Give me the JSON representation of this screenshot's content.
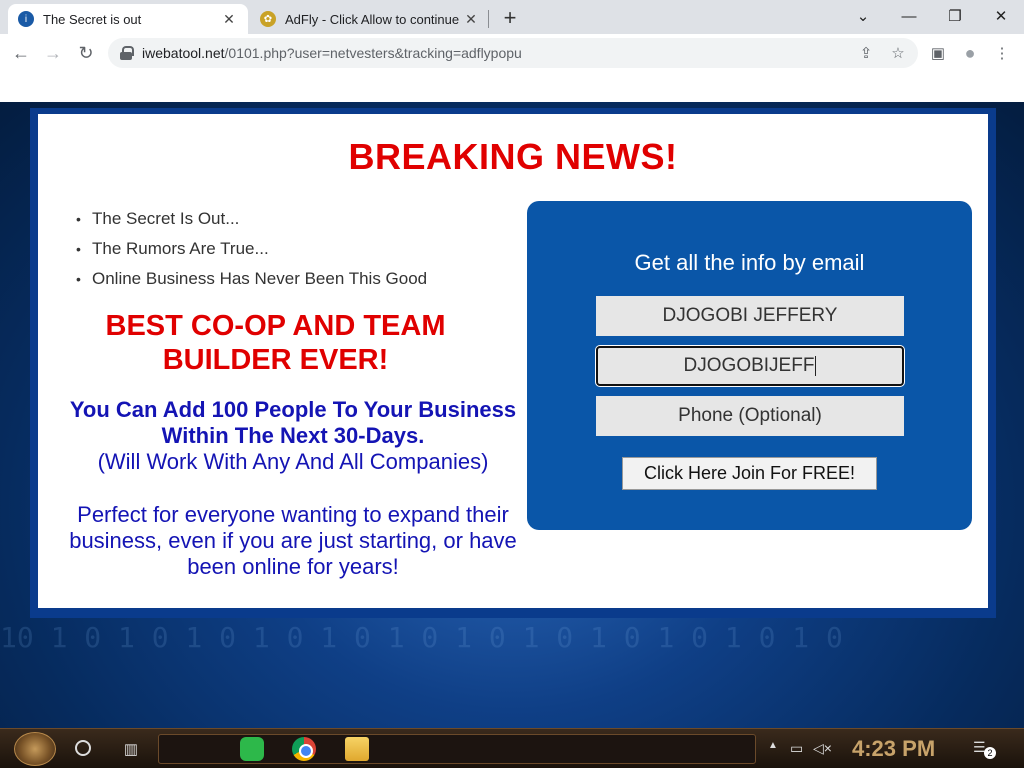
{
  "browser": {
    "tabs": [
      {
        "title": "The Secret is out",
        "active": true,
        "favicon": "info-icon"
      },
      {
        "title": "AdFly - Click Allow to continue",
        "active": false,
        "favicon": "adfly-icon"
      }
    ],
    "url_host": "iwebatool.net",
    "url_path": "/0101.php?user=netvesters&tracking=adflypopu",
    "icons": {
      "back": "←",
      "forward": "→",
      "reload": "↻",
      "share": "⇪",
      "star": "☆",
      "sidebar": "▣",
      "profile": "●",
      "menu": "⋮",
      "new_tab": "+",
      "minimize": "—",
      "restore": "❐",
      "close": "✕",
      "tab_close": "✕",
      "chevron": "⌄"
    }
  },
  "page": {
    "headline": "BREAKING NEWS!",
    "bullets": [
      "The Secret Is Out...",
      "The Rumors Are True...",
      "Online Business Has Never Been This Good"
    ],
    "red_title": "BEST CO-OP AND TEAM BUILDER EVER!",
    "blue_bold": "You Can Add 100 People To Your Business Within The Next 30-Days.",
    "blue_paren": "(Will Work With Any And All Companies)",
    "blue_body": "Perfect for everyone wanting to expand their business, even if you are just starting, or have been online for years!",
    "form": {
      "title": "Get all the info by email",
      "name_value": "DJOGOBI JEFFERY",
      "email_value": "DJOGOBIJEFF",
      "phone_placeholder": "Phone (Optional)",
      "submit_label": "Click Here Join For FREE!"
    },
    "background_digits": "10 1 0 1 0 1 0 1 0 1 0 1 0 1 0 1 0 1 0 1 0 1 0 1 0"
  },
  "taskbar": {
    "clock": "4:23 PM",
    "notification_count": "2"
  },
  "colors": {
    "headline_red": "#e00000",
    "body_blue": "#1414b4",
    "form_blue": "#0a56a8"
  }
}
